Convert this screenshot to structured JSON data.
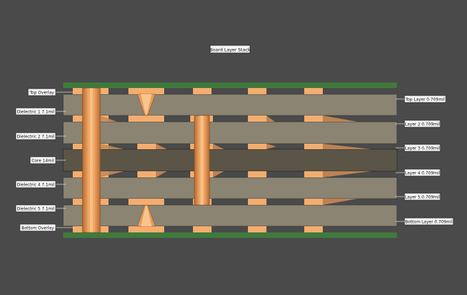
{
  "title": "Board Layer Stack",
  "colors": {
    "background": "#4a4a4a",
    "dielectric": "#8b8472",
    "core": "#5a5547",
    "copper": "#f3ad6e",
    "copper_dark": "#c9773a",
    "overlay": "#3f7a3c",
    "label_bg": "#f4f4f4",
    "label_border": "#2a2a2a",
    "leader": "#d8d8d8"
  },
  "left_labels": [
    {
      "id": "top-overlay",
      "text": "Top Overlay"
    },
    {
      "id": "dielectric-1",
      "text": "Dielectric 1 7.1mil"
    },
    {
      "id": "dielectric-2",
      "text": "Dielectric 2 7.1mil"
    },
    {
      "id": "core",
      "text": "Core 14mil"
    },
    {
      "id": "dielectric-4",
      "text": "Dielectric 4 7.1mil"
    },
    {
      "id": "dielectric-5",
      "text": "Dielectric 5 7.1mil"
    },
    {
      "id": "bottom-overlay",
      "text": "Bottom Overlay"
    }
  ],
  "right_labels": [
    {
      "id": "top-layer",
      "text": "Top Layer 0.709mil"
    },
    {
      "id": "layer-2",
      "text": "Layer 2 0.709mil"
    },
    {
      "id": "layer-3",
      "text": "Layer 3 0.709mil"
    },
    {
      "id": "layer-4",
      "text": "Layer 4 0.709mil"
    },
    {
      "id": "layer-5",
      "text": "Layer 5 0.709mil"
    },
    {
      "id": "bottom-layer",
      "text": "Bottom Layer 0.709mil"
    }
  ]
}
